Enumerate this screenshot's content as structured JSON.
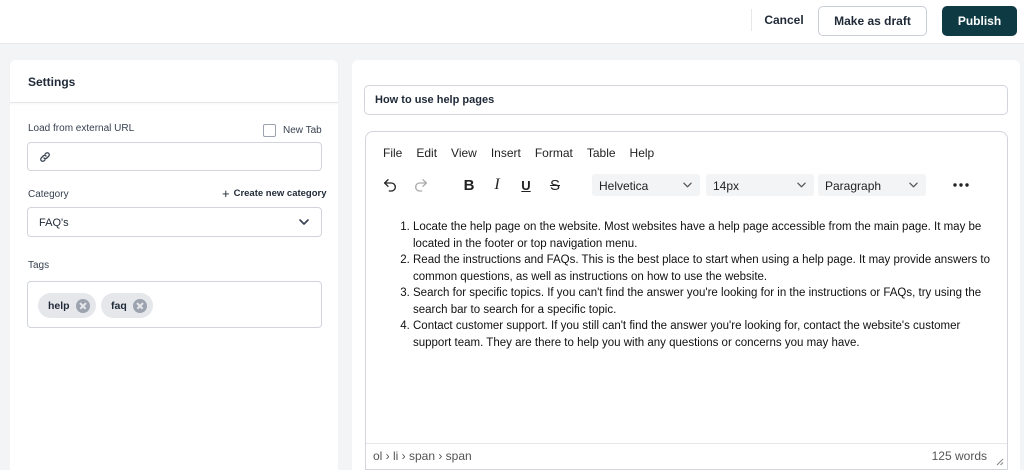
{
  "topbar": {
    "cancel_label": "Cancel",
    "draft_label": "Make as draft",
    "publish_label": "Publish",
    "publish_color": "#0e3b43"
  },
  "settings": {
    "title": "Settings",
    "url_label": "Load from external URL",
    "url_value": "",
    "url_icon": "link-icon",
    "newtab_label": "New Tab",
    "newtab_checked": false,
    "category_label": "Category",
    "create_category_label": "Create new category",
    "category_value": "FAQ's",
    "tags_label": "Tags",
    "tags": [
      {
        "label": "help"
      },
      {
        "label": "faq"
      }
    ]
  },
  "editor": {
    "title_value": "How to use help pages",
    "menu": [
      "File",
      "Edit",
      "View",
      "Insert",
      "Format",
      "Table",
      "Help"
    ],
    "toolbar": {
      "bold": "B",
      "italic": "I",
      "underline": "U",
      "strike": "S",
      "font_family": "Helvetica",
      "font_size": "14px",
      "block_format": "Paragraph"
    },
    "list_items": [
      "Locate the help page on the website. Most websites have a help page accessible from the main page. It may be located in the footer or top navigation menu.",
      "Read the instructions and FAQs. This is the best place to start when using a help page. It may provide answers to common questions, as well as instructions on how to use the website.",
      "Search for specific topics. If you can't find the answer you're looking for in the instructions or FAQs, try using the search bar to search for a specific topic.",
      "Contact customer support. If you still can't find the answer you're looking for, contact the website's customer support team. They are there to help you with any questions or concerns you may have."
    ],
    "path": "ol › li › span › span",
    "word_count": "125 words"
  }
}
